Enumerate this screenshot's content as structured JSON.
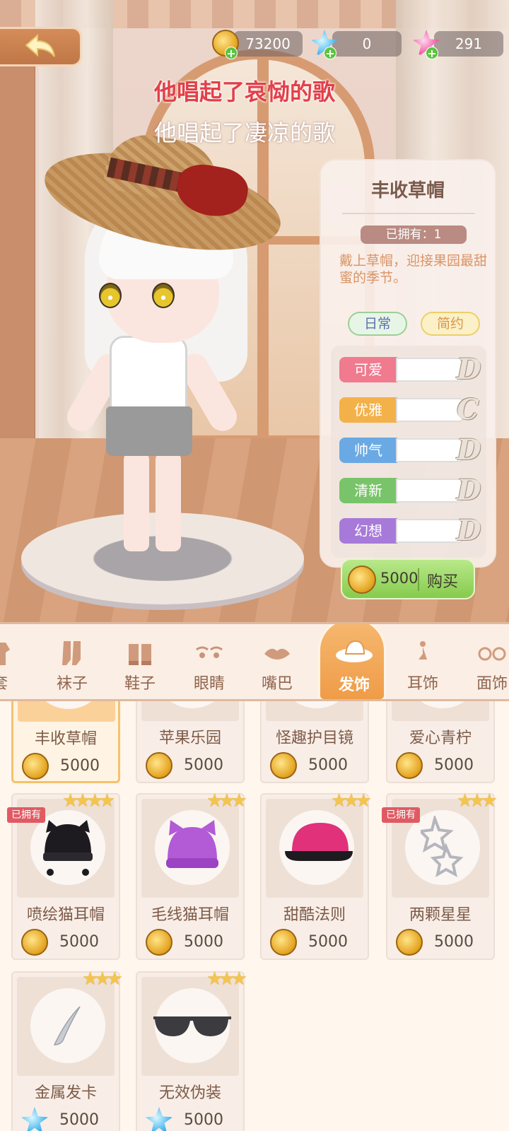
{
  "currencies": [
    {
      "icon": "gold-coin-icon",
      "value": "73200"
    },
    {
      "icon": "blue-diamond-icon",
      "value": "0"
    },
    {
      "icon": "pink-diamond-icon",
      "value": "291"
    }
  ],
  "lyrics": {
    "line1": "他唱起了哀恸的歌",
    "line2": "他唱起了凄凉的歌"
  },
  "item_panel": {
    "title": "丰收草帽",
    "owned": "已拥有：1",
    "description": "戴上草帽，迎接果园最甜蜜的季节。",
    "tags": [
      "日常",
      "简约"
    ],
    "stats": [
      {
        "label": "可爱",
        "grade": "D",
        "color": "#f07a8e"
      },
      {
        "label": "优雅",
        "grade": "C",
        "color": "#f3b14a"
      },
      {
        "label": "帅气",
        "grade": "D",
        "color": "#6aa9e4"
      },
      {
        "label": "清新",
        "grade": "D",
        "color": "#79c46a"
      },
      {
        "label": "幻想",
        "grade": "D",
        "color": "#a77ad9"
      }
    ],
    "buy": {
      "price": "5000",
      "label": "购买"
    }
  },
  "categories": [
    {
      "name": "套",
      "icon": "outfit-icon"
    },
    {
      "name": "袜子",
      "icon": "socks-icon"
    },
    {
      "name": "鞋子",
      "icon": "shoes-icon"
    },
    {
      "name": "眼睛",
      "icon": "eyes-icon"
    },
    {
      "name": "嘴巴",
      "icon": "mouth-icon"
    },
    {
      "name": "发饰",
      "icon": "hat-icon",
      "active": true
    },
    {
      "name": "耳饰",
      "icon": "earring-icon"
    },
    {
      "name": "面饰",
      "icon": "glasses-icon"
    }
  ],
  "items": [
    {
      "name": "丰收草帽",
      "price": "5000",
      "currency": "coin",
      "selected": true
    },
    {
      "name": "苹果乐园",
      "price": "5000",
      "currency": "coin"
    },
    {
      "name": "怪趣护目镜",
      "price": "5000",
      "currency": "coin"
    },
    {
      "name": "爱心青柠",
      "price": "5000",
      "currency": "coin"
    },
    {
      "name": "喷绘猫耳帽",
      "price": "5000",
      "currency": "coin",
      "stars": 4,
      "owned_badge": "已拥有"
    },
    {
      "name": "毛线猫耳帽",
      "price": "5000",
      "currency": "coin",
      "stars": 3
    },
    {
      "name": "甜酷法则",
      "price": "5000",
      "currency": "coin",
      "stars": 3
    },
    {
      "name": "两颗星星",
      "price": "5000",
      "currency": "coin",
      "stars": 3,
      "owned_badge": "已拥有"
    },
    {
      "name": "金属发卡",
      "price": "5000",
      "currency": "diamond",
      "stars": 3
    },
    {
      "name": "无效伪装",
      "price": "5000",
      "currency": "diamond",
      "stars": 3
    }
  ]
}
